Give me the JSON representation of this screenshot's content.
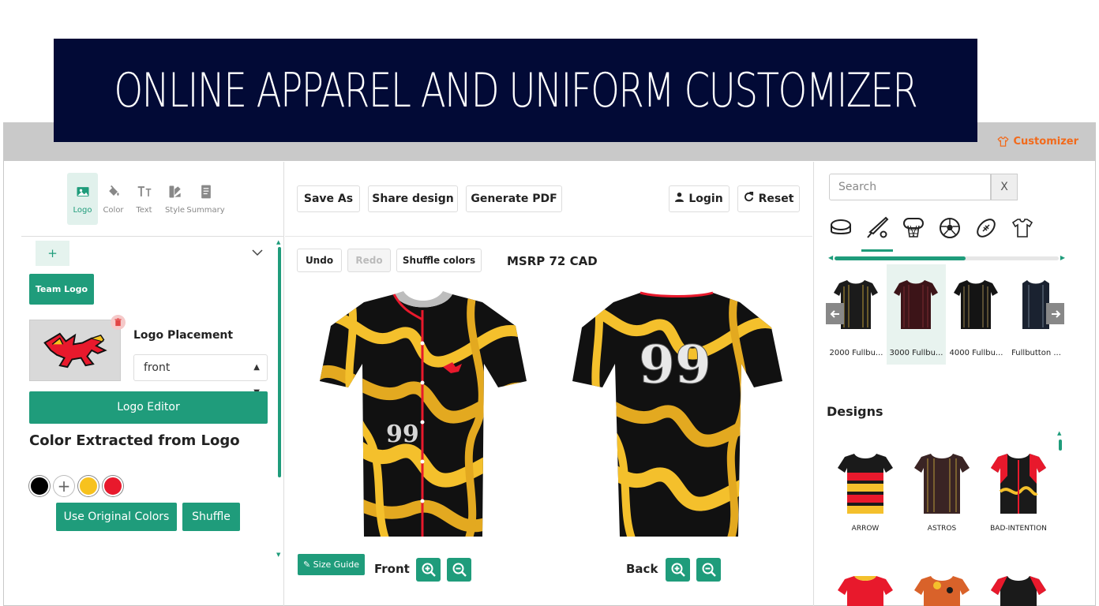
{
  "banner": {
    "title": "ONLINE APPAREL AND UNIFORM CUSTOMIZER"
  },
  "header": {
    "customizer_label": "Customizer"
  },
  "left": {
    "tabs": [
      "Logo",
      "Color",
      "Text",
      "Style",
      "Summary"
    ],
    "active_tab": "Logo",
    "add_label": "+",
    "team_logo_label": "Team Logo",
    "logo_placement_label": "Logo Placement",
    "placement_value": "front",
    "logo_editor_label": "Logo Editor",
    "color_heading": "Color Extracted from Logo",
    "swatch_colors": [
      "#000000",
      "add",
      "#f7c21e",
      "#e8192c"
    ],
    "use_original_label": "Use Original Colors",
    "shuffle_label": "Shuffle"
  },
  "center": {
    "save_as": "Save As",
    "share": "Share design",
    "generate_pdf": "Generate PDF",
    "login": "Login",
    "reset": "Reset",
    "undo": "Undo",
    "redo": "Redo",
    "shuffle_colors": "Shuffle colors",
    "msrp": "MSRP 72 CAD",
    "size_guide": "Size Guide",
    "front_label": "Front",
    "back_label": "Back",
    "jersey_number": "99"
  },
  "right": {
    "search_placeholder": "Search",
    "search_clear": "X",
    "sports": [
      "hockey-puck",
      "baseball-bat",
      "basketball",
      "soccer",
      "football",
      "tshirt"
    ],
    "products": [
      "2000 Fullbu...",
      "3000 Fullbu...",
      "4000 Fullbu...",
      "Fullbutton ..."
    ],
    "selected_product": "3000 Fullbu...",
    "designs_heading": "Designs",
    "designs": [
      "ARROW",
      "ASTROS",
      "BAD-INTENTION"
    ]
  },
  "colors": {
    "accent": "#1f9c7b",
    "banner": "#020a36",
    "orange": "#f26a1b"
  }
}
